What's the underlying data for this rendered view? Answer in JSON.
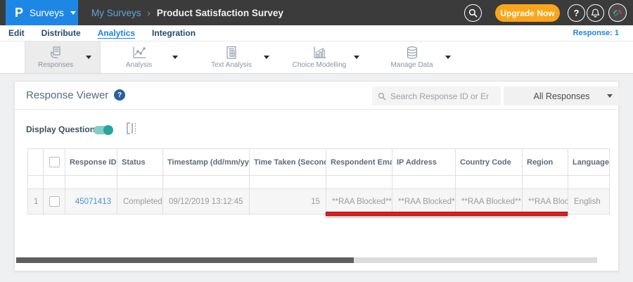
{
  "topbar": {
    "logo_glyph": "P",
    "product_menu_label": "Surveys",
    "breadcrumb": {
      "parent": "My Surveys",
      "separator": "›",
      "current": "Product Satisfaction Survey"
    },
    "upgrade_label": "Upgrade Now",
    "help_glyph": "?"
  },
  "nav": {
    "items": [
      {
        "label": "Edit",
        "active": false
      },
      {
        "label": "Distribute",
        "active": false
      },
      {
        "label": "Analytics",
        "active": true
      },
      {
        "label": "Integration",
        "active": false
      }
    ],
    "response_count": "Response: 1"
  },
  "toolbar": {
    "items": [
      {
        "label": "Responses",
        "icon": "responses-icon",
        "selected": true
      },
      {
        "label": "Analysis",
        "icon": "line-chart-icon",
        "selected": false
      },
      {
        "label": "Text Analysis",
        "icon": "text-analysis-icon",
        "selected": false
      },
      {
        "label": "Choice Modelling",
        "icon": "choice-modelling-icon",
        "selected": false
      },
      {
        "label": "Manage Data",
        "icon": "database-icon",
        "selected": false
      }
    ]
  },
  "viewer": {
    "title": "Response Viewer",
    "search_placeholder": "Search Response ID or Email",
    "filter_selected": "All Responses",
    "display_questions_label": "Display Questions",
    "display_questions_on": true
  },
  "table": {
    "columns": [
      {
        "id": "row-number",
        "label": ""
      },
      {
        "id": "select",
        "label": ""
      },
      {
        "id": "response-id",
        "label": "Response ID",
        "sorted": "desc"
      },
      {
        "id": "status",
        "label": "Status"
      },
      {
        "id": "timestamp",
        "label": "Timestamp (dd/mm/yyyy)",
        "sortable": true
      },
      {
        "id": "time-taken",
        "label": "Time Taken (Seconds)",
        "sortable": true
      },
      {
        "id": "respondent-email",
        "label": "Respondent Email"
      },
      {
        "id": "ip-address",
        "label": "IP Address"
      },
      {
        "id": "country-code",
        "label": "Country Code"
      },
      {
        "id": "region",
        "label": "Region"
      },
      {
        "id": "language",
        "label": "Language"
      }
    ],
    "rows": [
      {
        "row_number": "1",
        "response_id": "45071413",
        "status": "Completed",
        "timestamp": "09/12/2019 13:12:45",
        "time_taken": "15",
        "respondent_email": "**RAA Blocked**",
        "ip_address": "**RAA Blocked**",
        "country_code": "**RAA Blocked**",
        "region": "**RAA Blocked**",
        "language": "English"
      }
    ]
  },
  "colors": {
    "brand_blue": "#1e87e5",
    "accent_blue": "#1a84e0",
    "upgrade_orange": "#f9a61a",
    "toggle_teal": "#26a69a",
    "annotation_red": "#e01d1d",
    "topbar_dark": "#3b3b3b"
  }
}
